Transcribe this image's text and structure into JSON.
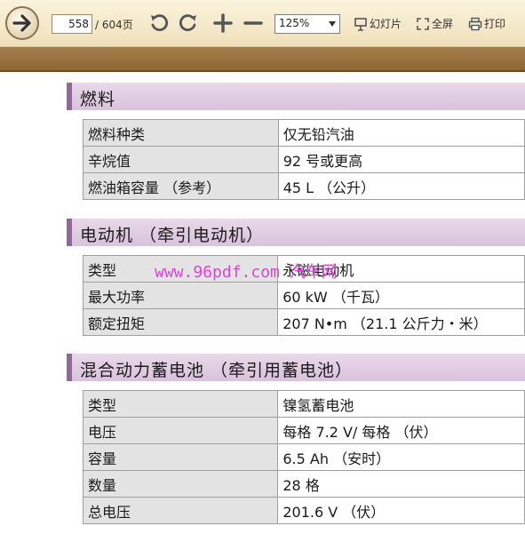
{
  "toolbar": {
    "page_current": "558",
    "page_total": "/ 604页",
    "zoom": "125%",
    "slideshow_label": "幻灯片",
    "fullscreen_label": "全屏",
    "print_label": "打印"
  },
  "watermark": "www.96pdf.com 汽车网",
  "sections": [
    {
      "title": "燃料",
      "rows": [
        {
          "key": "燃料种类",
          "value": "仅无铅汽油"
        },
        {
          "key": "辛烷值",
          "value": "92 号或更高"
        },
        {
          "key": "燃油箱容量 （参考）",
          "value": "45 L （公升）"
        }
      ]
    },
    {
      "title": "电动机 （牵引电动机）",
      "rows": [
        {
          "key": "类型",
          "value": "永磁电动机"
        },
        {
          "key": "最大功率",
          "value": "60 kW （千瓦）"
        },
        {
          "key": "额定扭矩",
          "value": "207 N•m （21.1 公斤力・米）"
        }
      ]
    },
    {
      "title": "混合动力蓄电池 （牵引用蓄电池）",
      "rows": [
        {
          "key": "类型",
          "value": "镍氢蓄电池"
        },
        {
          "key": "电压",
          "value": "每格 7.2 V/ 每格 （伏）"
        },
        {
          "key": "容量",
          "value": "6.5 Ah （安时）"
        },
        {
          "key": "数量",
          "value": "28 格"
        },
        {
          "key": "总电压",
          "value": "201.6 V （伏）"
        }
      ]
    }
  ]
}
